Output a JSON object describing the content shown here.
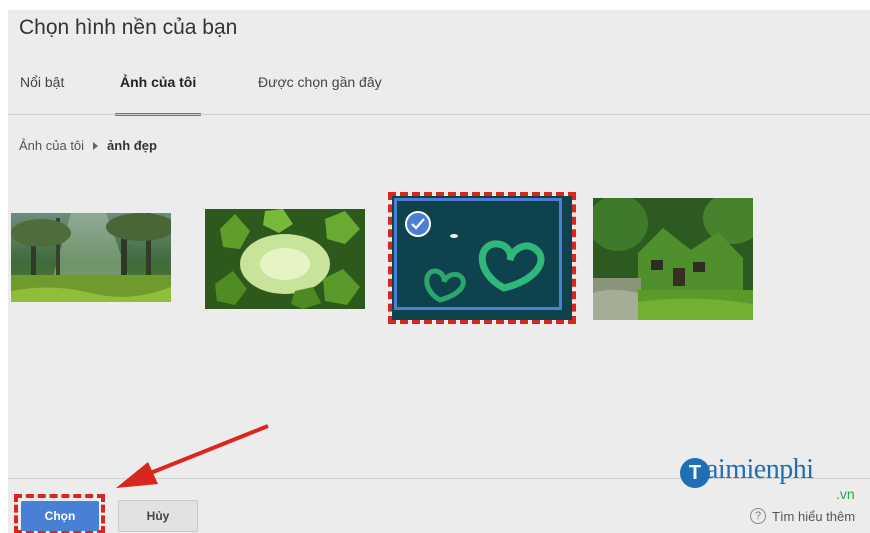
{
  "dialog": {
    "title": "Chọn hình nền của bạn"
  },
  "tabs": [
    {
      "label": "Nổi bật",
      "active": false
    },
    {
      "label": "Ảnh của tôi",
      "active": true
    },
    {
      "label": "Được chọn gần đây",
      "active": false
    }
  ],
  "breadcrumb": {
    "root": "Ảnh của tôi",
    "current": "ảnh đẹp"
  },
  "thumbnails": [
    {
      "subject": "misty forest with sun rays",
      "selected": false
    },
    {
      "subject": "green maple leaves",
      "selected": false
    },
    {
      "subject": "heart-shaped green islands in dark teal water",
      "selected": true
    },
    {
      "subject": "ivy-covered stone cottage",
      "selected": false
    }
  ],
  "footer": {
    "select_label": "Chọn",
    "cancel_label": "Hủy",
    "help_label": "Tìm hiểu thêm"
  },
  "watermark": {
    "logo_letter": "T",
    "name": "aimienphi",
    "tld": ".vn"
  },
  "colors": {
    "accent": "#4a7fd6",
    "annotation_red": "#d9271f",
    "overlay_bg": "#ececec",
    "watermark_blue": "#1f6fb5",
    "watermark_green": "#34a049"
  },
  "icons": {
    "check": "check-icon",
    "help": "question-circle-icon",
    "breadcrumb_separator": "triangle-right-icon"
  }
}
